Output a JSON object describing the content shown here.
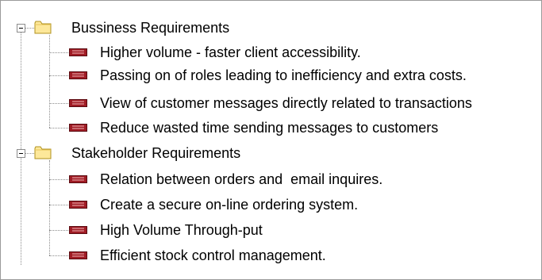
{
  "tree": {
    "groups": [
      {
        "label": "Bussiness Requirements",
        "icon": "folder-icon",
        "items": [
          {
            "label": "Higher volume - faster client accessibility.",
            "icon": "requirement-icon"
          },
          {
            "label": "Passing on of roles leading to inefficiency and extra costs.",
            "icon": "requirement-icon"
          },
          {
            "label": "View of customer messages directly related to transactions",
            "icon": "requirement-icon"
          },
          {
            "label": "Reduce wasted time sending messages to customers",
            "icon": "requirement-icon"
          }
        ]
      },
      {
        "label": "Stakeholder Requirements",
        "icon": "folder-icon",
        "items": [
          {
            "label": "Relation between orders and  email inquires.",
            "icon": "requirement-icon"
          },
          {
            "label": "Create a secure on-line ordering system.",
            "icon": "requirement-icon"
          },
          {
            "label": "High Volume Through-put",
            "icon": "requirement-icon"
          },
          {
            "label": "Efficient stock control management.",
            "icon": "requirement-icon"
          }
        ]
      }
    ]
  },
  "colors": {
    "folder_fill": "#fde89a",
    "folder_outline": "#b0911e",
    "requirement_fill": "#a01c25",
    "requirement_outline": "#5a0a10",
    "tree_lines": "#8c8c8c"
  }
}
